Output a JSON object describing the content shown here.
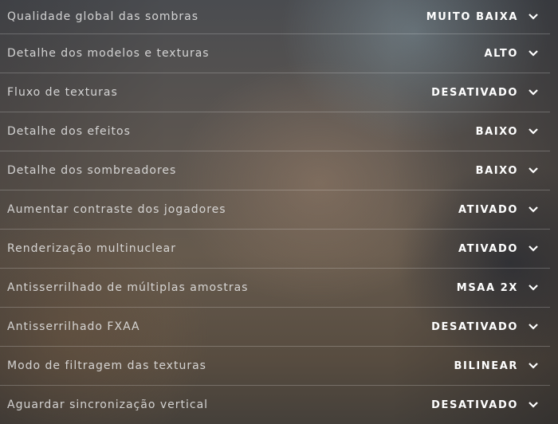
{
  "settings": [
    {
      "label": "Qualidade global das sombras",
      "value": "MUITO BAIXA",
      "icon": "chevron-down-icon"
    },
    {
      "label": "Detalhe dos modelos e texturas",
      "value": "ALTO",
      "icon": "chevron-down-icon"
    },
    {
      "label": "Fluxo de texturas",
      "value": "DESATIVADO",
      "icon": "chevron-down-icon"
    },
    {
      "label": "Detalhe dos efeitos",
      "value": "BAIXO",
      "icon": "chevron-down-icon"
    },
    {
      "label": "Detalhe dos sombreadores",
      "value": "BAIXO",
      "icon": "chevron-down-icon"
    },
    {
      "label": "Aumentar contraste dos jogadores",
      "value": "ATIVADO",
      "icon": "chevron-down-icon"
    },
    {
      "label": "Renderização multinuclear",
      "value": "ATIVADO",
      "icon": "chevron-down-icon"
    },
    {
      "label": "Antisserrilhado de múltiplas amostras",
      "value": "MSAA 2X",
      "icon": "chevron-down-icon"
    },
    {
      "label": "Antisserrilhado FXAA",
      "value": "DESATIVADO",
      "icon": "chevron-down-icon"
    },
    {
      "label": "Modo de filtragem das texturas",
      "value": "BILINEAR",
      "icon": "chevron-down-icon"
    },
    {
      "label": "Aguardar sincronização vertical",
      "value": "DESATIVADO",
      "icon": "chevron-down-icon"
    }
  ],
  "colors": {
    "label_text": "#e6e6e6",
    "value_text": "#ffffff",
    "divider": "#ffffff"
  }
}
